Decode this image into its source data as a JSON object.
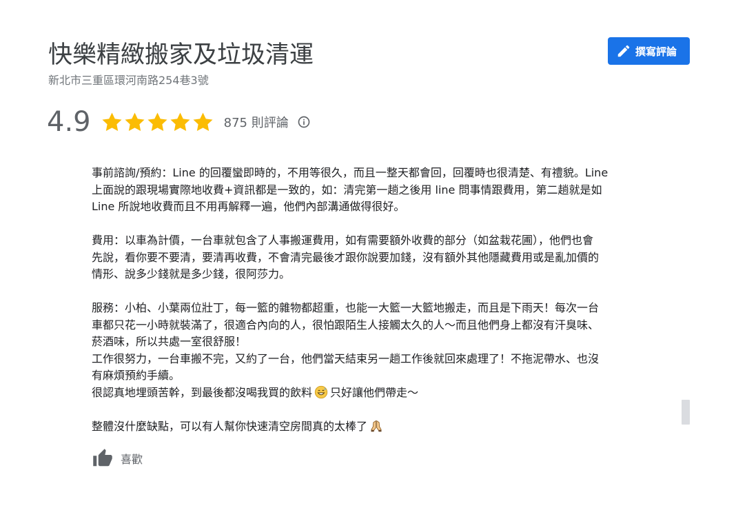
{
  "business": {
    "name": "快樂精緻搬家及垃圾清運",
    "address": "新北市三重區環河南路254巷3號"
  },
  "write_review": {
    "label": "撰寫評論",
    "icon": "pencil-icon",
    "bg_color": "#1a73e8"
  },
  "rating": {
    "score": "4.9",
    "stars": 5,
    "star_color": "#fbbc04",
    "count_label": "875 則評論",
    "info_icon": "info-icon"
  },
  "review": {
    "paragraphs": [
      {
        "lines": [
          "事前諮詢/預約：Line 的回覆蠻即時的，不用等很久，而且一整天都會回，回覆時也很清楚、有禮貌。Line",
          "上面說的跟現場實際地收費+資訊都是一致的，如：清完第一趟之後用 line 問事情跟費用，第二趟就是如",
          "Line 所說地收費而且不用再解釋一遍，他們內部溝通做得很好。"
        ]
      },
      {
        "lines": [
          "費用：以車為計價，一台車就包含了人事搬運費用，如有需要額外收費的部分（如盆栽花圃），他們也會",
          "先說，看你要不要清，要清再收費，不會清完最後才跟你說要加錢，沒有額外其他隱藏費用或是亂加價的",
          "情形、說多少錢就是多少錢，很阿莎力。"
        ]
      },
      {
        "lines": [
          "服務：小柏、小葉兩位壯丁，每一籃的雜物都超重，也能一大籃一大籃地搬走，而且是下雨天！每次一台",
          "車都只花一小時就裝滿了，很適合內向的人，很怕跟陌生人接觸太久的人～而且他們身上都沒有汗臭味、",
          "菸酒味，所以共處一室很舒服！",
          "工作很努力，一台車搬不完，又約了一台，他們當天結束另一趟工作後就回來處理了！不拖泥帶水、也沒",
          "有麻煩預約手續。"
        ],
        "last_line_before": "很認真地埋頭苦幹，到最後都沒喝我買的飲料",
        "last_line_emoji": "grinning-sweat-emoji",
        "last_line_after": "只好讓他們帶走～"
      },
      {
        "text": "整體沒什麼缺點，可以有人幫你快速清空房間真的太棒了",
        "emoji": "praying-hands-emoji"
      }
    ]
  },
  "like": {
    "label": "喜歡",
    "icon": "thumbs-up-icon"
  }
}
